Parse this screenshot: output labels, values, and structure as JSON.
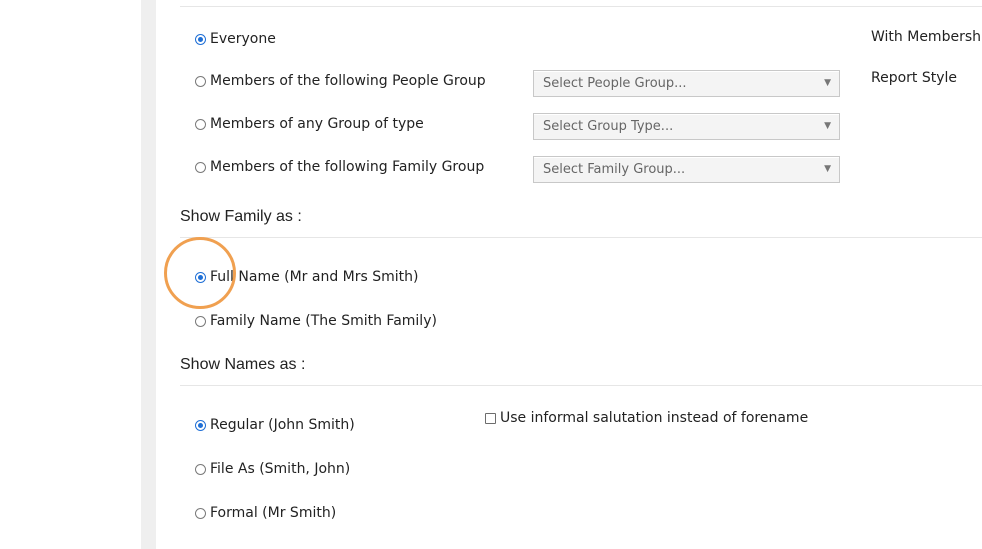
{
  "filters": {
    "everyone": "Everyone",
    "people_group": "Members of the following People Group",
    "group_type": "Members of any Group of type",
    "family_group": "Members of the following Family Group",
    "people_group_select_placeholder": "Select People Group...",
    "group_type_select_placeholder": "Select Group Type...",
    "family_group_select_placeholder": "Select Family Group..."
  },
  "right_panel": {
    "with_membership": "With Membership",
    "report_style": "Report Style"
  },
  "show_family": {
    "title": "Show Family as :",
    "full_name": "Full Name (Mr and Mrs Smith)",
    "family_name": "Family Name (The Smith Family)"
  },
  "show_names": {
    "title": "Show Names as :",
    "regular": "Regular (John Smith)",
    "file_as": "File As (Smith, John)",
    "formal": "Formal (Mr Smith)",
    "informal_checkbox": "Use informal salutation instead of forename"
  },
  "colors": {
    "radio_checked": "#1f6fd6",
    "highlight": "#f0a050"
  }
}
